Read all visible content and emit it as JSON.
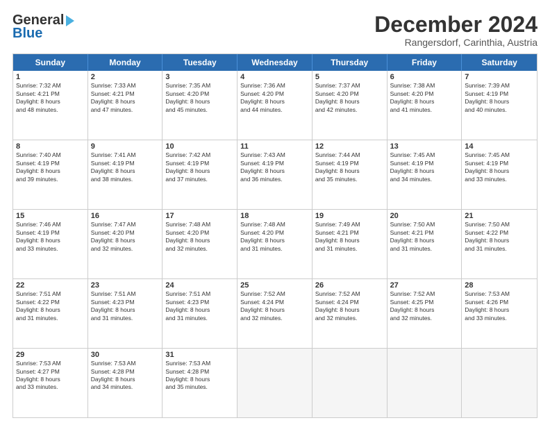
{
  "header": {
    "logo_line1": "General",
    "logo_line2": "Blue",
    "title": "December 2024",
    "subtitle": "Rangersdorf, Carinthia, Austria"
  },
  "days": [
    "Sunday",
    "Monday",
    "Tuesday",
    "Wednesday",
    "Thursday",
    "Friday",
    "Saturday"
  ],
  "weeks": [
    [
      {
        "day": "1",
        "lines": [
          "Sunrise: 7:32 AM",
          "Sunset: 4:21 PM",
          "Daylight: 8 hours",
          "and 48 minutes."
        ]
      },
      {
        "day": "2",
        "lines": [
          "Sunrise: 7:33 AM",
          "Sunset: 4:21 PM",
          "Daylight: 8 hours",
          "and 47 minutes."
        ]
      },
      {
        "day": "3",
        "lines": [
          "Sunrise: 7:35 AM",
          "Sunset: 4:20 PM",
          "Daylight: 8 hours",
          "and 45 minutes."
        ]
      },
      {
        "day": "4",
        "lines": [
          "Sunrise: 7:36 AM",
          "Sunset: 4:20 PM",
          "Daylight: 8 hours",
          "and 44 minutes."
        ]
      },
      {
        "day": "5",
        "lines": [
          "Sunrise: 7:37 AM",
          "Sunset: 4:20 PM",
          "Daylight: 8 hours",
          "and 42 minutes."
        ]
      },
      {
        "day": "6",
        "lines": [
          "Sunrise: 7:38 AM",
          "Sunset: 4:20 PM",
          "Daylight: 8 hours",
          "and 41 minutes."
        ]
      },
      {
        "day": "7",
        "lines": [
          "Sunrise: 7:39 AM",
          "Sunset: 4:19 PM",
          "Daylight: 8 hours",
          "and 40 minutes."
        ]
      }
    ],
    [
      {
        "day": "8",
        "lines": [
          "Sunrise: 7:40 AM",
          "Sunset: 4:19 PM",
          "Daylight: 8 hours",
          "and 39 minutes."
        ]
      },
      {
        "day": "9",
        "lines": [
          "Sunrise: 7:41 AM",
          "Sunset: 4:19 PM",
          "Daylight: 8 hours",
          "and 38 minutes."
        ]
      },
      {
        "day": "10",
        "lines": [
          "Sunrise: 7:42 AM",
          "Sunset: 4:19 PM",
          "Daylight: 8 hours",
          "and 37 minutes."
        ]
      },
      {
        "day": "11",
        "lines": [
          "Sunrise: 7:43 AM",
          "Sunset: 4:19 PM",
          "Daylight: 8 hours",
          "and 36 minutes."
        ]
      },
      {
        "day": "12",
        "lines": [
          "Sunrise: 7:44 AM",
          "Sunset: 4:19 PM",
          "Daylight: 8 hours",
          "and 35 minutes."
        ]
      },
      {
        "day": "13",
        "lines": [
          "Sunrise: 7:45 AM",
          "Sunset: 4:19 PM",
          "Daylight: 8 hours",
          "and 34 minutes."
        ]
      },
      {
        "day": "14",
        "lines": [
          "Sunrise: 7:45 AM",
          "Sunset: 4:19 PM",
          "Daylight: 8 hours",
          "and 33 minutes."
        ]
      }
    ],
    [
      {
        "day": "15",
        "lines": [
          "Sunrise: 7:46 AM",
          "Sunset: 4:19 PM",
          "Daylight: 8 hours",
          "and 33 minutes."
        ]
      },
      {
        "day": "16",
        "lines": [
          "Sunrise: 7:47 AM",
          "Sunset: 4:20 PM",
          "Daylight: 8 hours",
          "and 32 minutes."
        ]
      },
      {
        "day": "17",
        "lines": [
          "Sunrise: 7:48 AM",
          "Sunset: 4:20 PM",
          "Daylight: 8 hours",
          "and 32 minutes."
        ]
      },
      {
        "day": "18",
        "lines": [
          "Sunrise: 7:48 AM",
          "Sunset: 4:20 PM",
          "Daylight: 8 hours",
          "and 31 minutes."
        ]
      },
      {
        "day": "19",
        "lines": [
          "Sunrise: 7:49 AM",
          "Sunset: 4:21 PM",
          "Daylight: 8 hours",
          "and 31 minutes."
        ]
      },
      {
        "day": "20",
        "lines": [
          "Sunrise: 7:50 AM",
          "Sunset: 4:21 PM",
          "Daylight: 8 hours",
          "and 31 minutes."
        ]
      },
      {
        "day": "21",
        "lines": [
          "Sunrise: 7:50 AM",
          "Sunset: 4:22 PM",
          "Daylight: 8 hours",
          "and 31 minutes."
        ]
      }
    ],
    [
      {
        "day": "22",
        "lines": [
          "Sunrise: 7:51 AM",
          "Sunset: 4:22 PM",
          "Daylight: 8 hours",
          "and 31 minutes."
        ]
      },
      {
        "day": "23",
        "lines": [
          "Sunrise: 7:51 AM",
          "Sunset: 4:23 PM",
          "Daylight: 8 hours",
          "and 31 minutes."
        ]
      },
      {
        "day": "24",
        "lines": [
          "Sunrise: 7:51 AM",
          "Sunset: 4:23 PM",
          "Daylight: 8 hours",
          "and 31 minutes."
        ]
      },
      {
        "day": "25",
        "lines": [
          "Sunrise: 7:52 AM",
          "Sunset: 4:24 PM",
          "Daylight: 8 hours",
          "and 32 minutes."
        ]
      },
      {
        "day": "26",
        "lines": [
          "Sunrise: 7:52 AM",
          "Sunset: 4:24 PM",
          "Daylight: 8 hours",
          "and 32 minutes."
        ]
      },
      {
        "day": "27",
        "lines": [
          "Sunrise: 7:52 AM",
          "Sunset: 4:25 PM",
          "Daylight: 8 hours",
          "and 32 minutes."
        ]
      },
      {
        "day": "28",
        "lines": [
          "Sunrise: 7:53 AM",
          "Sunset: 4:26 PM",
          "Daylight: 8 hours",
          "and 33 minutes."
        ]
      }
    ],
    [
      {
        "day": "29",
        "lines": [
          "Sunrise: 7:53 AM",
          "Sunset: 4:27 PM",
          "Daylight: 8 hours",
          "and 33 minutes."
        ]
      },
      {
        "day": "30",
        "lines": [
          "Sunrise: 7:53 AM",
          "Sunset: 4:28 PM",
          "Daylight: 8 hours",
          "and 34 minutes."
        ]
      },
      {
        "day": "31",
        "lines": [
          "Sunrise: 7:53 AM",
          "Sunset: 4:28 PM",
          "Daylight: 8 hours",
          "and 35 minutes."
        ]
      },
      null,
      null,
      null,
      null
    ]
  ]
}
